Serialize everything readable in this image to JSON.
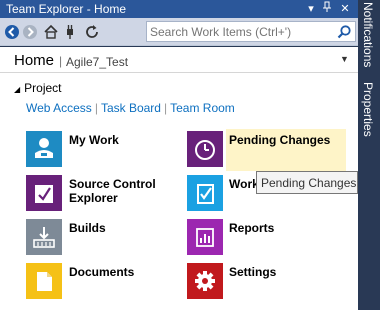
{
  "window": {
    "title": "Team Explorer - Home",
    "buttons": {
      "dropdown": "▾",
      "pin": "ᵖ",
      "close": "✕"
    }
  },
  "side_tabs": [
    "Notifications",
    "Properties"
  ],
  "toolbar": {
    "search_placeholder": "Search Work Items (Ctrl+')"
  },
  "header": {
    "title": "Home",
    "separator": "|",
    "project": "Agile7_Test"
  },
  "project_section": {
    "label": "Project",
    "links": [
      "Web Access",
      "Task Board",
      "Team Room"
    ]
  },
  "tiles": [
    {
      "label": "My Work",
      "color": "#1e8bc3",
      "icon": "my-work-icon"
    },
    {
      "label": "Pending Changes",
      "color": "#68217a",
      "icon": "clock-icon"
    },
    {
      "label": "Source Control Explorer",
      "color": "#68217a",
      "icon": "source-control-icon"
    },
    {
      "label": "Work Items",
      "color": "#1ba1e2",
      "icon": "work-items-icon"
    },
    {
      "label": "Builds",
      "color": "#7e8a97",
      "icon": "builds-icon"
    },
    {
      "label": "Reports",
      "color": "#9c27b0",
      "icon": "reports-icon"
    },
    {
      "label": "Documents",
      "color": "#f5c116",
      "icon": "document-icon"
    },
    {
      "label": "Settings",
      "color": "#c1191d",
      "icon": "gear-icon"
    }
  ],
  "tooltip": "Pending Changes"
}
